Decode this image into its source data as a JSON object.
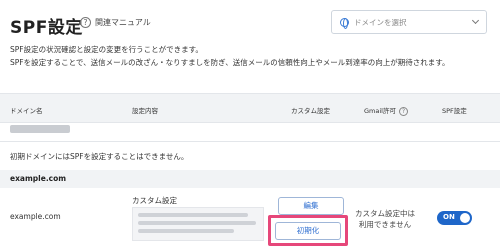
{
  "header": {
    "title": "SPF設定",
    "help_label": "関連マニュアル",
    "domain_select_placeholder": "ドメインを選択"
  },
  "description": {
    "line1": "SPF設定の状況確認と設定の変更を行うことができます。",
    "line2": "SPFを設定することで、送信メールの改ざん・なりすましを防ぎ、送信メールの信頼性向上やメール到達率の向上が期待されます。"
  },
  "table": {
    "columns": {
      "domain": "ドメイン名",
      "settings": "設定内容",
      "custom": "カスタム設定",
      "gmail": "Gmail許可",
      "spf": "SPF設定"
    },
    "initial_domain_note": "初期ドメインにはSPFを設定することはできません。",
    "group_label": "example.com",
    "row": {
      "domain": "example.com",
      "custom_label": "カスタム設定",
      "edit_button": "編集",
      "init_button": "初期化",
      "gmail_status_line1": "カスタム設定中は",
      "gmail_status_line2": "利用できません",
      "toggle_label": "ON"
    }
  },
  "colors": {
    "accent": "#1e66c9",
    "highlight": "#e6477a"
  }
}
